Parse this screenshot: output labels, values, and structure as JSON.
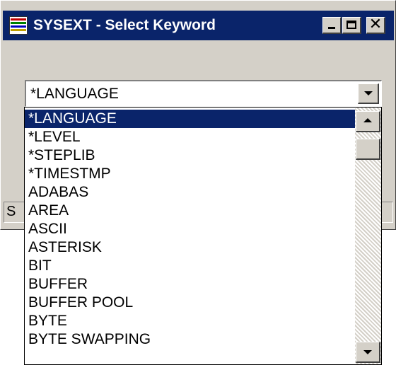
{
  "window": {
    "title": "SYSEXT - Select Keyword",
    "app_icon": "sysext-app-icon",
    "controls": {
      "minimize_icon": "minimize-icon",
      "maximize_icon": "maximize-icon",
      "close_icon": "close-icon",
      "close_glyph": "✕"
    }
  },
  "combo": {
    "selected_value": "*LANGUAGE",
    "dropdown_icon": "chevron-down-icon"
  },
  "status_bar": {
    "text": "S"
  },
  "list": {
    "selected_index": 0,
    "items": [
      "*LANGUAGE",
      "*LEVEL",
      "*STEPLIB",
      "*TIMESTMP",
      "ADABAS",
      "AREA",
      "ASCII",
      "ASTERISK",
      "BIT",
      "BUFFER",
      "BUFFER POOL",
      "BYTE",
      "BYTE SWAPPING"
    ],
    "scroll_up_icon": "scroll-up-icon",
    "scroll_down_icon": "scroll-down-icon"
  },
  "colors": {
    "titlebar": "#0a246a",
    "selection": "#0a246a",
    "face": "#d4d0c8"
  }
}
